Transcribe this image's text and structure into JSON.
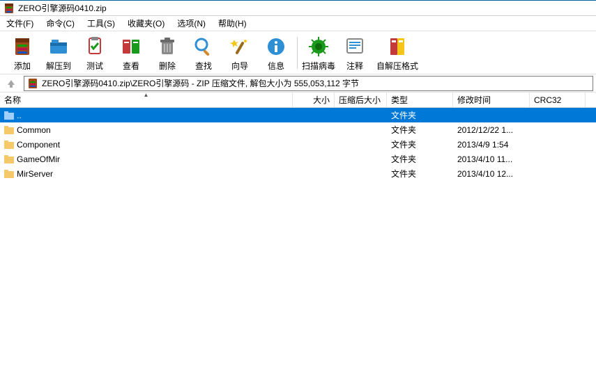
{
  "window": {
    "title": "ZERO引擎源码0410.zip"
  },
  "menu": {
    "file": "文件(F)",
    "cmd": "命令(C)",
    "tools": "工具(S)",
    "fav": "收藏夹(O)",
    "opt": "选项(N)",
    "help": "帮助(H)"
  },
  "toolbar": {
    "add": "添加",
    "extract": "解压到",
    "test": "测试",
    "view": "查看",
    "delete": "删除",
    "find": "查找",
    "wizard": "向导",
    "info": "信息",
    "virus": "扫描病毒",
    "comment": "注释",
    "sfx": "自解压格式"
  },
  "pathbar": {
    "text": "ZERO引擎源码0410.zip\\ZERO引擎源码 - ZIP 压缩文件, 解包大小为 555,053,112 字节"
  },
  "columns": {
    "name": "名称",
    "size": "大小",
    "csize": "压缩后大小",
    "type": "类型",
    "mtime": "修改时间",
    "crc": "CRC32"
  },
  "rows": [
    {
      "name": "..",
      "size": "",
      "csize": "",
      "type": "文件夹",
      "mtime": "",
      "crc": "",
      "selected": true,
      "up": true
    },
    {
      "name": "Common",
      "size": "",
      "csize": "",
      "type": "文件夹",
      "mtime": "2012/12/22 1...",
      "crc": ""
    },
    {
      "name": "Component",
      "size": "",
      "csize": "",
      "type": "文件夹",
      "mtime": "2013/4/9 1:54",
      "crc": ""
    },
    {
      "name": "GameOfMir",
      "size": "",
      "csize": "",
      "type": "文件夹",
      "mtime": "2013/4/10 11...",
      "crc": ""
    },
    {
      "name": "MirServer",
      "size": "",
      "csize": "",
      "type": "文件夹",
      "mtime": "2013/4/10 12...",
      "crc": ""
    }
  ]
}
